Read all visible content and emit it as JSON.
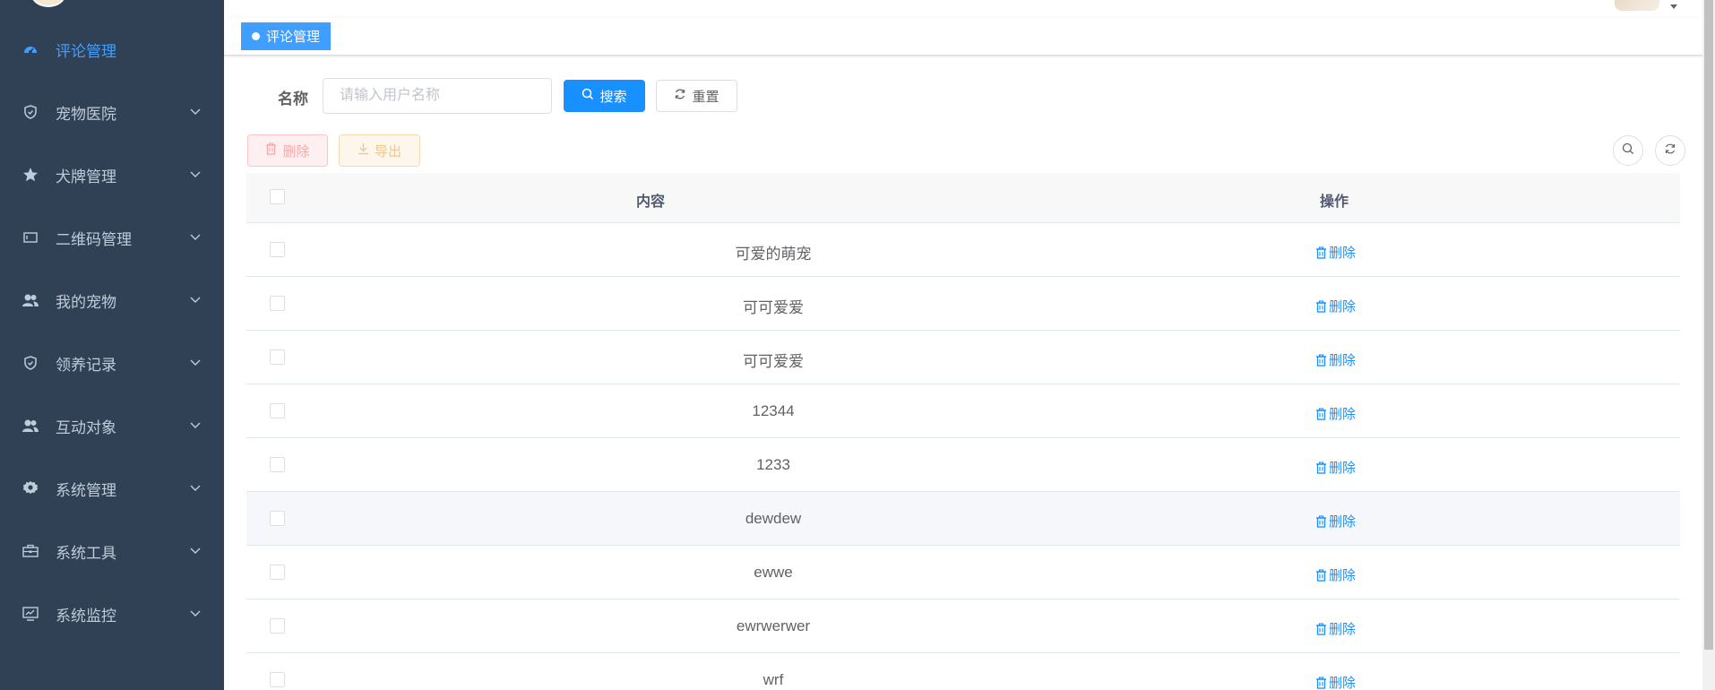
{
  "sidebar": {
    "items": [
      {
        "label": "评论管理",
        "icon": "dashboard-icon",
        "active": true
      },
      {
        "label": "宠物医院",
        "icon": "shield-icon"
      },
      {
        "label": "犬牌管理",
        "icon": "star-icon"
      },
      {
        "label": "二维码管理",
        "icon": "card-icon"
      },
      {
        "label": "我的宠物",
        "icon": "peoples-icon"
      },
      {
        "label": "领养记录",
        "icon": "shield-icon"
      },
      {
        "label": "互动对象",
        "icon": "peoples-icon"
      },
      {
        "label": "系统管理",
        "icon": "gear-icon"
      },
      {
        "label": "系统工具",
        "icon": "toolbox-icon"
      },
      {
        "label": "系统监控",
        "icon": "monitor-icon"
      }
    ]
  },
  "tags": {
    "active": "评论管理"
  },
  "search": {
    "label": "名称",
    "placeholder": "请输入用户名称",
    "search_btn": "搜索",
    "reset_btn": "重置"
  },
  "toolbar": {
    "delete_btn": "删除",
    "export_btn": "导出"
  },
  "table": {
    "headers": {
      "content": "内容",
      "op": "操作"
    },
    "op_label": "删除",
    "rows": [
      {
        "content": "可爱的萌宠"
      },
      {
        "content": "可可爱爱"
      },
      {
        "content": "可可爱爱"
      },
      {
        "content": "12344"
      },
      {
        "content": "1233"
      },
      {
        "content": "dewdew"
      },
      {
        "content": "ewwe"
      },
      {
        "content": "ewrwerwer"
      },
      {
        "content": "wrf"
      }
    ]
  },
  "colors": {
    "sidebar_bg": "#304156",
    "active": "#409eff",
    "primary": "#1890ff"
  }
}
